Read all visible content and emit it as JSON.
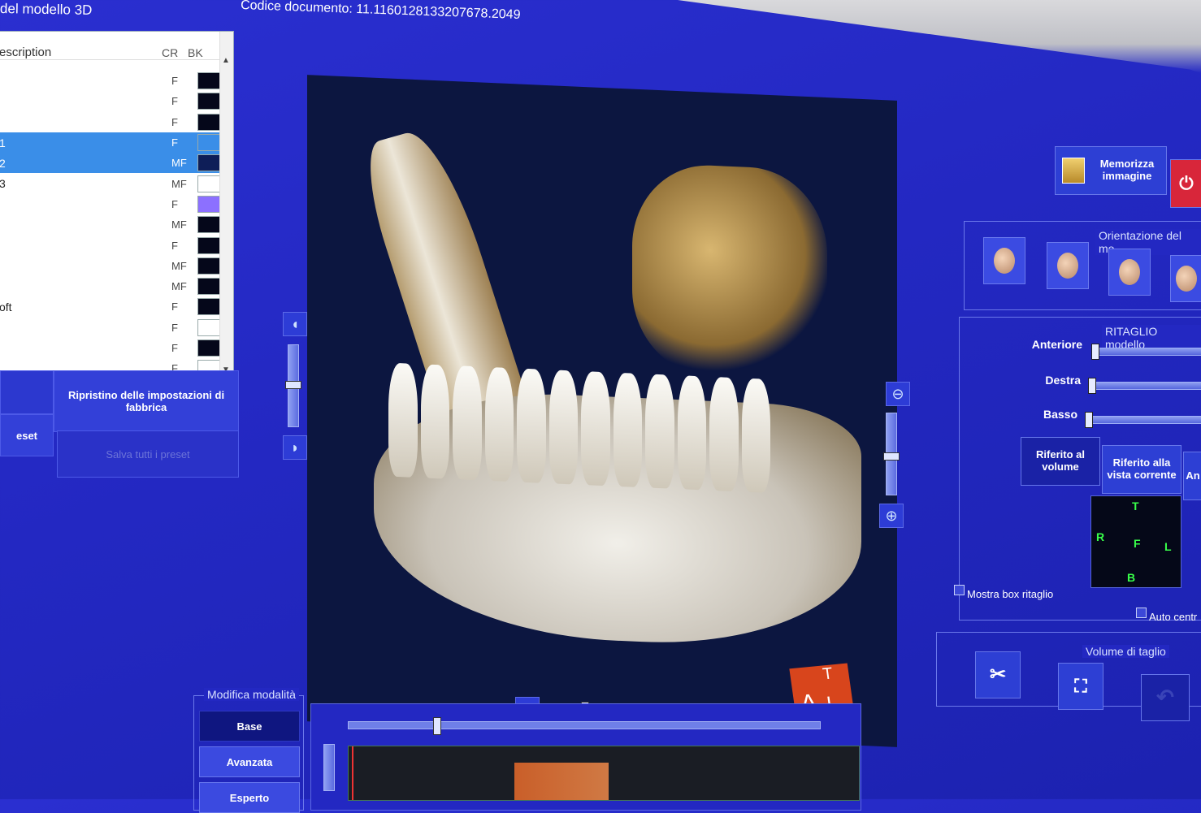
{
  "window": {
    "title": "del modello 3D",
    "doc_code": "Codice documento: 11.1160128133207678.2049"
  },
  "table": {
    "headers": {
      "description": "escription",
      "cr": "CR",
      "bk": "BK"
    },
    "rows": [
      {
        "name": "",
        "cr": "F",
        "color": "#05071a",
        "selected": false
      },
      {
        "name": "",
        "cr": "F",
        "color": "#05071a",
        "selected": false
      },
      {
        "name": "",
        "cr": "F",
        "color": "#05071a",
        "selected": false
      },
      {
        "name": "1",
        "cr": "F",
        "color": "#3a8ee8",
        "selected": true
      },
      {
        "name": "2",
        "cr": "MF",
        "color": "#0e1e58",
        "selected": true
      },
      {
        "name": "3",
        "cr": "MF",
        "color": "#ffffff",
        "selected": false
      },
      {
        "name": "",
        "cr": "F",
        "color": "#8c70ff",
        "selected": false
      },
      {
        "name": "",
        "cr": "MF",
        "color": "#05071a",
        "selected": false
      },
      {
        "name": "",
        "cr": "F",
        "color": "#05071a",
        "selected": false
      },
      {
        "name": "",
        "cr": "MF",
        "color": "#05071a",
        "selected": false
      },
      {
        "name": "",
        "cr": "MF",
        "color": "#05071a",
        "selected": false
      },
      {
        "name": "oft",
        "cr": "F",
        "color": "#05071a",
        "selected": false
      },
      {
        "name": "",
        "cr": "F",
        "color": "#ffffff",
        "selected": false
      },
      {
        "name": "",
        "cr": "F",
        "color": "#05071a",
        "selected": false
      },
      {
        "name": "",
        "cr": "F",
        "color": "#ffffff",
        "selected": false
      },
      {
        "name": "",
        "cr": "F",
        "color": "#ffffff",
        "selected": false
      }
    ]
  },
  "left_buttons": {
    "reset_factory": "Ripristino delle impostazioni di fabbrica",
    "preset": "eset",
    "save_all": "Salva tutti i preset"
  },
  "right_panel": {
    "save_image": "Memorizza immagine",
    "orientation_title": "Orientazione del mo",
    "crop_title": "RITAGLIO modello",
    "sliders": [
      {
        "label": "Anteriore",
        "value": 0
      },
      {
        "label": "Destra",
        "value": 0
      },
      {
        "label": "Basso",
        "value": 0
      }
    ],
    "ref_volume": "Riferito al volume",
    "ref_view": "Riferito alla vista corrente",
    "ref_other": "An",
    "cube_labels": {
      "top": "T",
      "bottom": "B",
      "left": "R",
      "right": "L",
      "front": "F"
    },
    "show_crop_box": "Mostra box ritaglio",
    "auto_center": "Auto centr",
    "cut_volume_title": "Volume di taglio"
  },
  "viewer": {
    "cube_letters": [
      "T",
      "A",
      "L"
    ]
  },
  "mode": {
    "title": "Modifica modalità",
    "buttons": [
      "Base",
      "Avanzata",
      "Esperto"
    ],
    "active": "Base"
  },
  "colors": {
    "background": "#2328c2",
    "accent_power": "#d8263a"
  }
}
